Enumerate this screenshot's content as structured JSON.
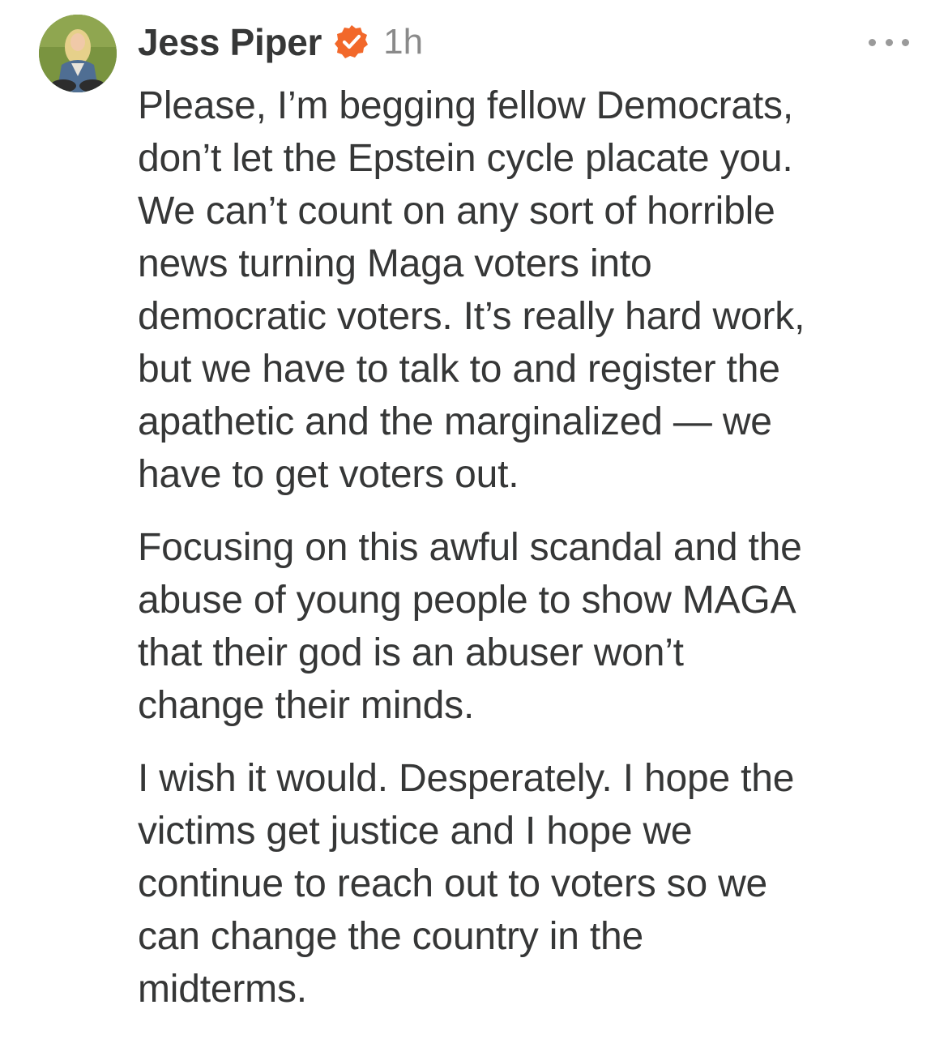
{
  "post": {
    "author": {
      "name": "Jess Piper",
      "avatar": "avatar",
      "verified_icon": "verified-badge-icon",
      "verified_color": "#f2682a"
    },
    "time": "1h",
    "more_icon": "more-options-icon",
    "paragraphs": [
      {
        "lines": [
          "Please, I’m begging fellow Democrats,",
          "don’t let the Epstein cycle placate you.",
          "We can’t count on any sort of horrible",
          "news turning Maga voters into",
          "democratic voters. It’s really hard work,",
          "but we have to talk to and register the",
          "apathetic and the marginalized — we",
          "have to get voters out."
        ]
      },
      {
        "lines": [
          "Focusing on this awful scandal and the",
          "abuse of young people to show MAGA",
          "that their god is an abuser won’t",
          "change their minds."
        ]
      },
      {
        "lines": [
          "I wish it would. Desperately. I hope the",
          "victims get justice and I hope we",
          "continue to reach out to voters so we",
          "can change the country in the",
          "midterms."
        ]
      }
    ]
  }
}
